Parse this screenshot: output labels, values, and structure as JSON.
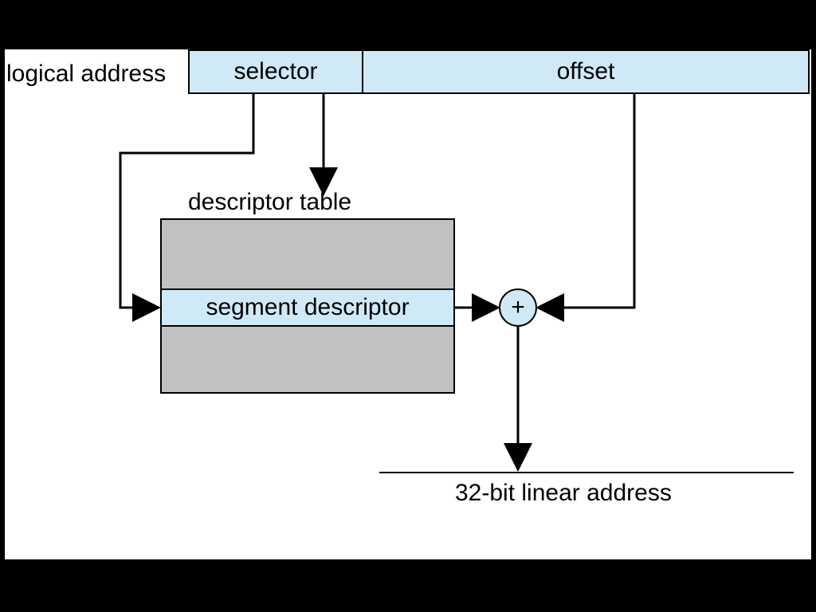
{
  "labels": {
    "logical_address": "logical address",
    "selector": "selector",
    "offset": "offset",
    "descriptor_table": "descriptor table",
    "segment_descriptor": "segment descriptor",
    "adder": "+",
    "result": "32-bit linear address"
  }
}
